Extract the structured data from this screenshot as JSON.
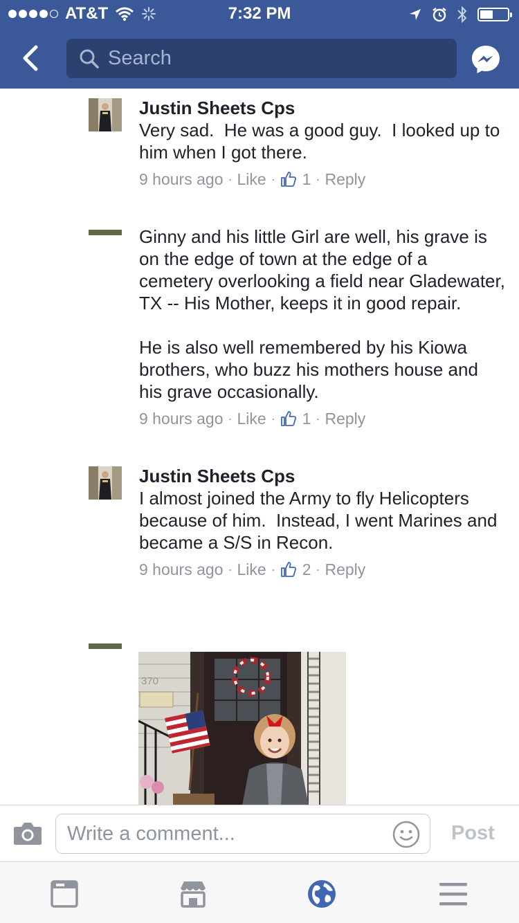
{
  "status_bar": {
    "carrier": "AT&T",
    "time": "7:32 PM"
  },
  "nav": {
    "search_placeholder": "Search"
  },
  "comments": [
    {
      "author": "Justin Sheets Cps",
      "text": "Very sad.  He was a good guy.  I looked up to him when I got there.",
      "time": "9 hours ago",
      "like": "Like",
      "likes_count": "1",
      "reply": "Reply"
    },
    {
      "author": "",
      "text": "Ginny and his little Girl are well, his grave is on the edge of town at the edge of a cemetery overlooking a field near Gladewater, TX -- His Mother, keeps it in good repair.\n\nHe is also well remembered by his Kiowa brothers, who buzz his mothers house and his grave occasionally.",
      "time": "9 hours ago",
      "like": "Like",
      "likes_count": "1",
      "reply": "Reply"
    },
    {
      "author": "Justin Sheets Cps",
      "text": "I almost joined the Army to fly Helicopters because of him.  Instead, I went Marines and became a S/S in Recon.",
      "time": "9 hours ago",
      "like": "Like",
      "likes_count": "2",
      "reply": "Reply"
    }
  ],
  "photo": {
    "house_number": "370"
  },
  "composer": {
    "placeholder": "Write a comment...",
    "post_label": "Post"
  },
  "colors": {
    "brand": "#3b5998",
    "search_bg": "#2b4170",
    "meta_text": "#90949c",
    "like_icon": "#4267b2"
  },
  "icons": {
    "back": "chevron-left-icon",
    "search": "search-icon",
    "messenger": "messenger-icon",
    "thumb": "thumbs-up-icon",
    "camera": "camera-icon",
    "emoji": "emoji-icon",
    "tabs": [
      "news-feed-icon",
      "marketplace-icon",
      "notifications-globe-icon",
      "menu-icon"
    ]
  }
}
